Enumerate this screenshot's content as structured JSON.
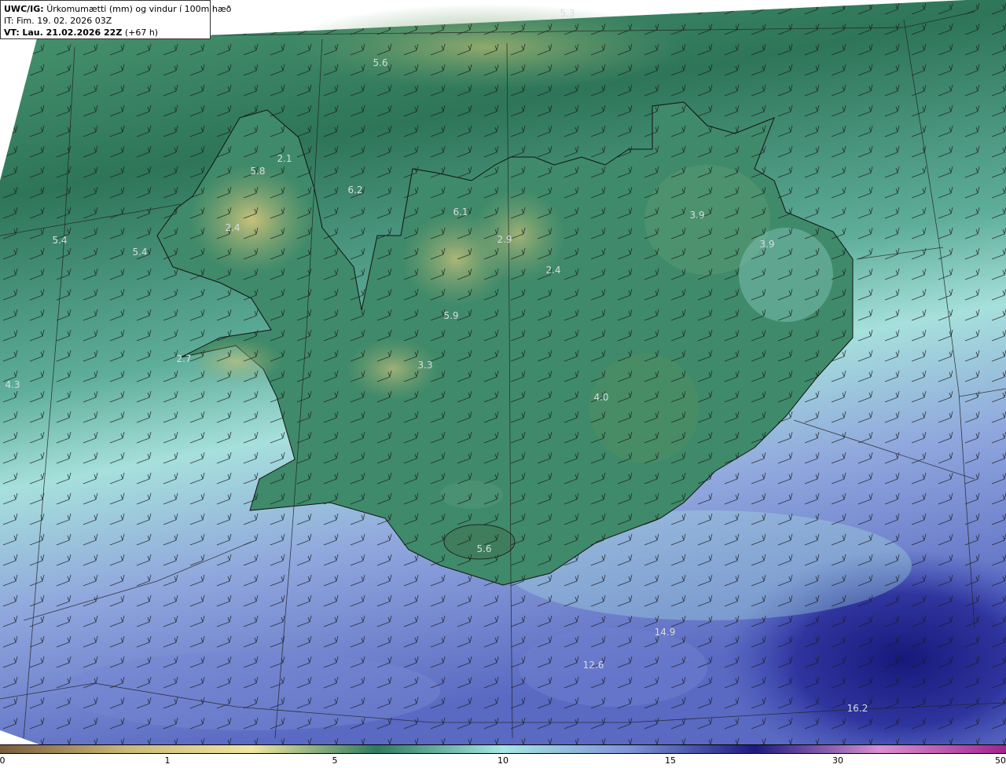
{
  "header": {
    "prefix": "UWC/IG:",
    "title": "Úrkomumætti (mm) og vindur í 100m hæð",
    "it_prefix": "IT:",
    "it_value": "Fim. 19. 02. 2026 03Z",
    "vt_prefix": "VT:",
    "vt_value": "Lau. 21.02.2026 22Z",
    "vt_suffix": "(+67 h)"
  },
  "colorbar": {
    "ticks": [
      "0",
      "1",
      "5",
      "10",
      "15",
      "30",
      "50"
    ],
    "colors": [
      "#7a5a3c",
      "#c9b878",
      "#f0e6a0",
      "#2f7a5e",
      "#a8e6e4",
      "#7d94d6",
      "#1c1a7c",
      "#d98fd2",
      "#a0248c"
    ]
  },
  "map_values": [
    "5.3",
    "5.6",
    "5.8",
    "2.1",
    "6.2",
    "5.4",
    "5.4",
    "2.4",
    "6.1",
    "2.9",
    "3.9",
    "3.9",
    "2.4",
    "5.9",
    "3.3",
    "2.7",
    "4.3",
    "4.0",
    "5.6",
    "14.9",
    "12.6",
    "16.2"
  ],
  "field_colors": {
    "dry_land": "#b9b46e",
    "green": "#3f8a6a",
    "dark_green": "#2a6e52",
    "cyan": "#9fdcd9",
    "blue": "#5a6fc0",
    "navy": "#1a1c86"
  }
}
